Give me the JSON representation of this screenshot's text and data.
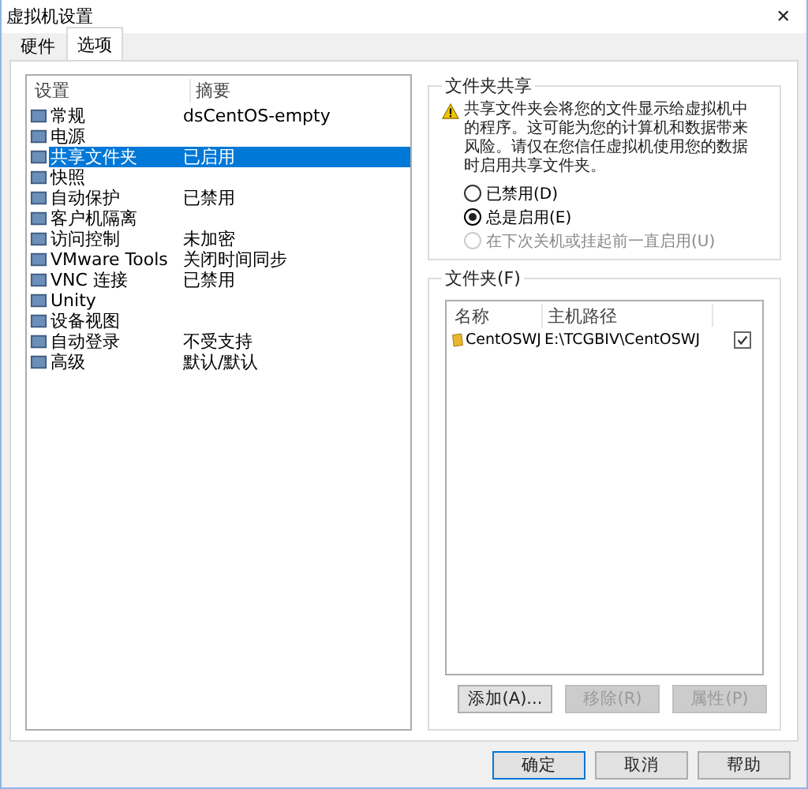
{
  "window": {
    "title": "虚拟机设置",
    "close": "✕"
  },
  "tabs": [
    {
      "label": "硬件",
      "selected": false
    },
    {
      "label": "选项",
      "selected": true
    }
  ],
  "settings": {
    "columns": [
      "设置",
      "摘要"
    ],
    "rows": [
      {
        "name": "常规",
        "summary": "dsCentOS-empty",
        "selected": false
      },
      {
        "name": "电源",
        "summary": "",
        "selected": false
      },
      {
        "name": "共享文件夹",
        "summary": "已启用",
        "selected": true
      },
      {
        "name": "快照",
        "summary": "",
        "selected": false
      },
      {
        "name": "自动保护",
        "summary": "已禁用",
        "selected": false
      },
      {
        "name": "客户机隔离",
        "summary": "",
        "selected": false
      },
      {
        "name": "访问控制",
        "summary": "未加密",
        "selected": false
      },
      {
        "name": "VMware Tools",
        "summary": "关闭时间同步",
        "selected": false
      },
      {
        "name": "VNC 连接",
        "summary": "已禁用",
        "selected": false
      },
      {
        "name": "Unity",
        "summary": "",
        "selected": false
      },
      {
        "name": "设备视图",
        "summary": "",
        "selected": false
      },
      {
        "name": "自动登录",
        "summary": "不受支持",
        "selected": false
      },
      {
        "name": "高级",
        "summary": "默认/默认",
        "selected": false
      }
    ]
  },
  "sharing": {
    "title": "文件夹共享",
    "warning": "共享文件夹会将您的文件显示给虚拟机中的程序。这可能为您的计算机和数据带来风险。请仅在您信任虚拟机使用您的数据时启用共享文件夹。",
    "options": [
      {
        "label": "已禁用(D)",
        "selected": false,
        "disabled": false
      },
      {
        "label": "总是启用(E)",
        "selected": true,
        "disabled": false
      },
      {
        "label": "在下次关机或挂起前一直启用(U)",
        "selected": false,
        "disabled": true
      }
    ]
  },
  "folders": {
    "title": "文件夹(F)",
    "columns": [
      "名称",
      "主机路径"
    ],
    "rows": [
      {
        "name": "CentOSWJ",
        "path": "E:\\TCGBIV\\CentOSWJ",
        "checked": true
      }
    ],
    "buttons": [
      {
        "label": "添加(A)...",
        "disabled": false
      },
      {
        "label": "移除(R)",
        "disabled": true
      },
      {
        "label": "属性(P)",
        "disabled": true
      }
    ]
  },
  "footer": [
    {
      "label": "确定",
      "default": true
    },
    {
      "label": "取消",
      "default": false
    },
    {
      "label": "帮助",
      "default": false
    }
  ]
}
